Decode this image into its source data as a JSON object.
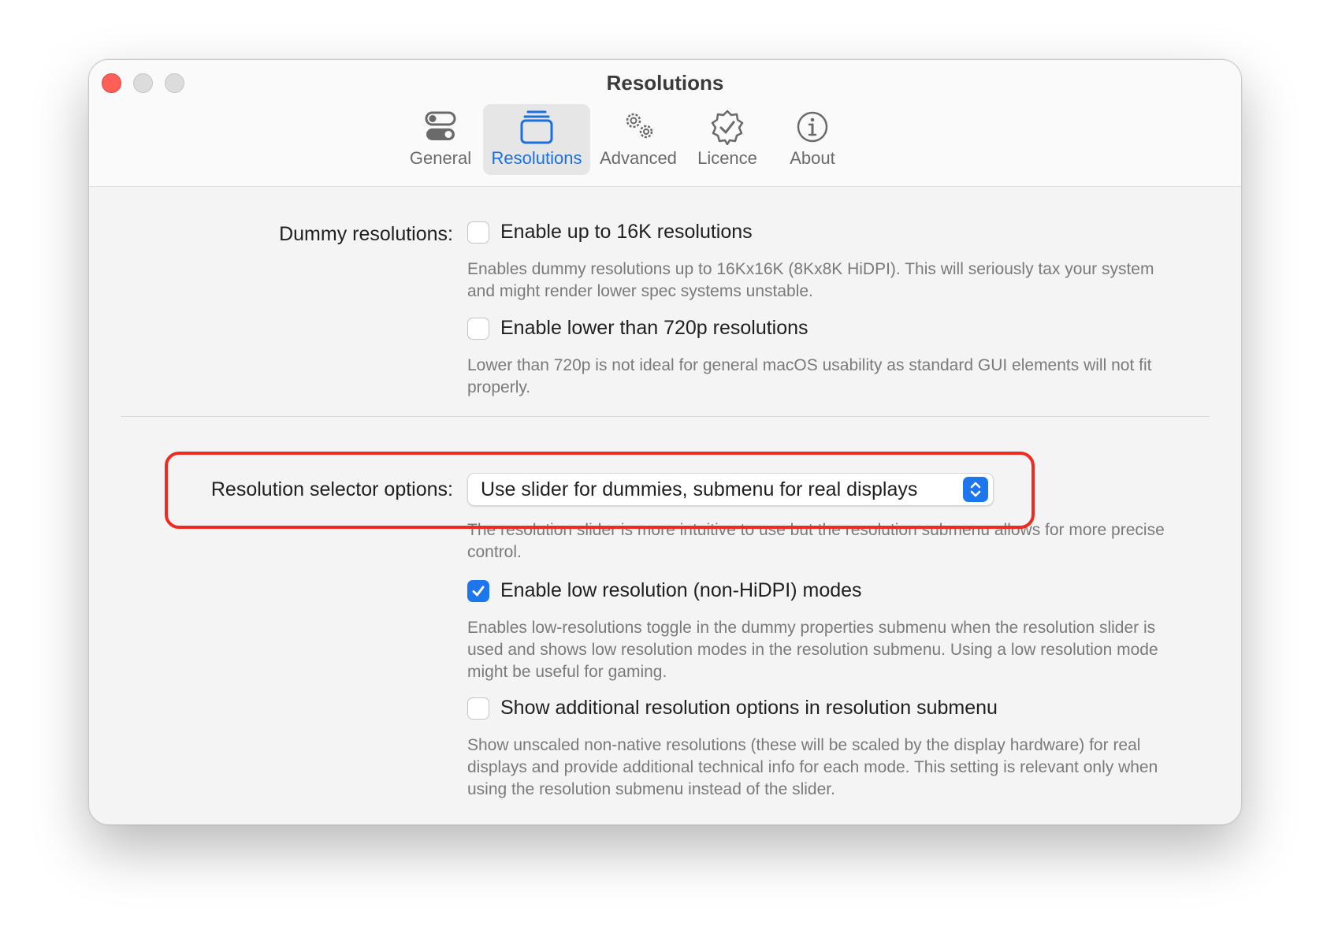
{
  "window": {
    "title": "Resolutions",
    "traffic_lights": [
      "close",
      "minimize",
      "zoom"
    ]
  },
  "tabs": [
    {
      "label": "General",
      "icon": "toggles-icon",
      "active": false
    },
    {
      "label": "Resolutions",
      "icon": "display-stack-icon",
      "active": true
    },
    {
      "label": "Advanced",
      "icon": "gears-icon",
      "active": false
    },
    {
      "label": "Licence",
      "icon": "seal-check-icon",
      "active": false
    },
    {
      "label": "About",
      "icon": "info-circle-icon",
      "active": false
    }
  ],
  "dummy": {
    "label": "Dummy resolutions:",
    "opt16k": {
      "label": "Enable up to 16K resolutions",
      "checked": false,
      "desc": "Enables dummy resolutions up to 16Kx16K (8Kx8K HiDPI). This will seriously tax your system and might render lower spec systems unstable."
    },
    "opt720": {
      "label": "Enable lower than 720p resolutions",
      "checked": false,
      "desc": "Lower than 720p is not ideal for general macOS usability as standard GUI elements will not fit properly."
    }
  },
  "selector": {
    "label": "Resolution selector options:",
    "value": "Use slider for dummies, submenu for real displays",
    "desc": "The resolution slider is more intuitive to use but the resolution submenu allows for more precise control.",
    "highlight_color": "#ef2a20"
  },
  "lowres": {
    "label": "Enable low resolution (non-HiDPI) modes",
    "checked": true,
    "desc": "Enables low-resolutions toggle in the dummy properties submenu when the resolution slider is used and shows low resolution modes in the resolution submenu. Using a low resolution mode might be useful for gaming."
  },
  "additional": {
    "label": "Show additional resolution options in resolution submenu",
    "checked": false,
    "desc": "Show unscaled non-native resolutions (these will be scaled by the display hardware) for real displays and provide additional technical info for each mode. This setting is relevant only when using the resolution submenu instead of the slider."
  },
  "colors": {
    "accent": "#1e76ec",
    "close": "#ff5f57"
  }
}
